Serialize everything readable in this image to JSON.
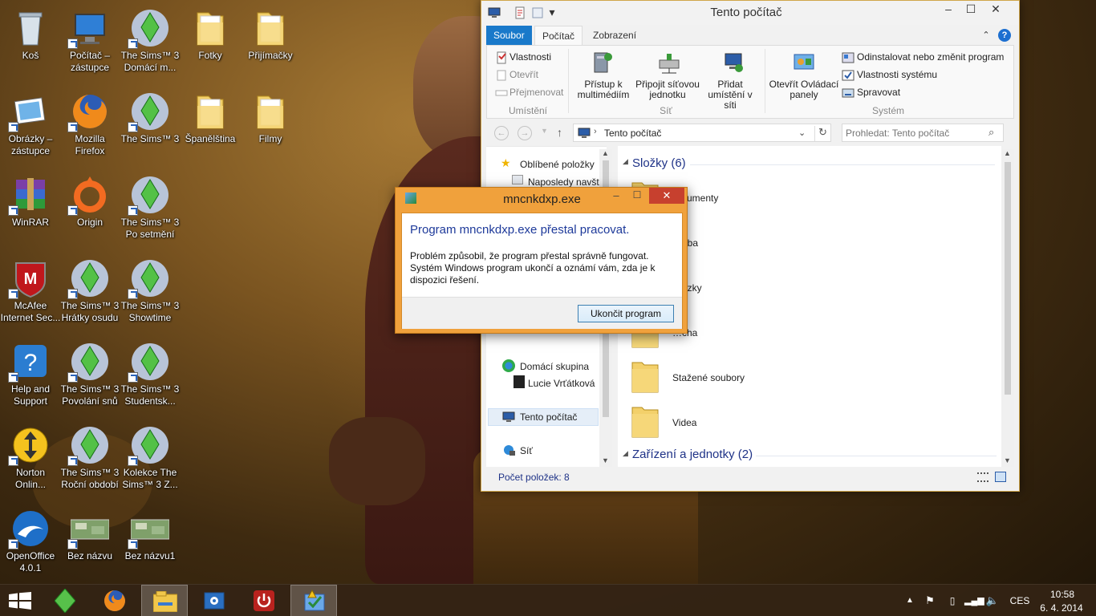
{
  "desktop": {
    "icons": [
      {
        "label": "Koš",
        "icon": "recycle-bin-icon"
      },
      {
        "label": "Počítač –\nzástupce",
        "icon": "computer-icon"
      },
      {
        "label": "The Sims™ 3\nDomácí m...",
        "icon": "sims-plumbob-icon"
      },
      {
        "label": "Fotky",
        "icon": "folder-icon"
      },
      {
        "label": "Přijímačky",
        "icon": "folder-icon"
      },
      {
        "label": "Obrázky –\nzástupce",
        "icon": "pictures-icon"
      },
      {
        "label": "Mozilla\nFirefox",
        "icon": "firefox-icon"
      },
      {
        "label": "The Sims™ 3",
        "icon": "sims-plumbob-icon"
      },
      {
        "label": "Španělština",
        "icon": "folder-icon"
      },
      {
        "label": "Filmy",
        "icon": "folder-icon"
      },
      {
        "label": "WinRAR",
        "icon": "winrar-icon"
      },
      {
        "label": "Origin",
        "icon": "origin-icon"
      },
      {
        "label": "The Sims™ 3\nPo setmění",
        "icon": "sims-plumbob-icon"
      },
      {
        "label": "McAfee\nInternet Sec...",
        "icon": "mcafee-icon"
      },
      {
        "label": "The Sims™ 3\nHrátky osudu",
        "icon": "sims-plumbob-icon"
      },
      {
        "label": "The Sims™ 3\nShowtime",
        "icon": "sims-plumbob-icon"
      },
      {
        "label": "Help and\nSupport",
        "icon": "help-icon"
      },
      {
        "label": "The Sims™ 3\nPovolání snů",
        "icon": "sims-plumbob-icon"
      },
      {
        "label": "The Sims™ 3\nStudentsk...",
        "icon": "sims-plumbob-icon"
      },
      {
        "label": "Norton\nOnlin...",
        "icon": "norton-icon"
      },
      {
        "label": "The Sims™ 3\nRoční období",
        "icon": "sims-plumbob-icon"
      },
      {
        "label": "Kolekce The\nSims™ 3 Z...",
        "icon": "sims-plumbob-icon"
      },
      {
        "label": "OpenOffice\n4.0.1",
        "icon": "openoffice-icon"
      },
      {
        "label": "Bez názvu",
        "icon": "image-thumbnail-icon"
      },
      {
        "label": "Bez názvu1",
        "icon": "image-thumbnail-icon"
      }
    ]
  },
  "explorer": {
    "title": "Tento počítač",
    "tabs": {
      "file": "Soubor",
      "computer": "Počítač",
      "view": "Zobrazení"
    },
    "ribbon": {
      "properties": "Vlastnosti",
      "open": "Otevřít",
      "rename": "Přejmenovat",
      "group_location": "Umístění",
      "media_access": "Přístup k\nmultimédiím",
      "map_drive": "Připojit síťovou\njednotku",
      "add_location": "Přidat\numístění v síti",
      "group_network": "Síť",
      "control_panel": "Otevřít Ovládací\npanely",
      "uninstall": "Odinstalovat nebo změnit program",
      "system_props": "Vlastnosti systému",
      "manage": "Spravovat",
      "group_system": "Systém"
    },
    "address": "Tento počítač",
    "search_placeholder": "Prohledat: Tento počítač",
    "nav": {
      "favorites": "Oblíbené položky",
      "recent": "Naposledy navšt",
      "homegroup": "Domácí skupina",
      "user": "Lucie Vrťátková",
      "this_pc": "Tento počítač",
      "network": "Síť"
    },
    "main": {
      "folders_group": "Složky (6)",
      "folders": [
        "…kumenty",
        "…dba",
        "…ázky",
        "…cha",
        "Stažené soubory",
        "Videa"
      ],
      "devices_group": "Zařízení a jednotky (2)"
    },
    "status": "Počet položek: 8"
  },
  "dialog": {
    "title": "mncnkdxp.exe",
    "heading": "Program mncnkdxp.exe přestal pracovat.",
    "message": "Problém způsobil, že program přestal správně fungovat. Systém Windows program ukončí a oznámí vám, zda je k dispozici řešení.",
    "button": "Ukončit program"
  },
  "taskbar": {
    "apps": [
      "start-icon",
      "sims-plumbob-icon",
      "firefox-icon",
      "file-explorer-icon",
      "settings-icon",
      "power-icon",
      "action-center-icon"
    ],
    "language": "CES",
    "time": "10:58",
    "date": "6. 4. 2014"
  }
}
